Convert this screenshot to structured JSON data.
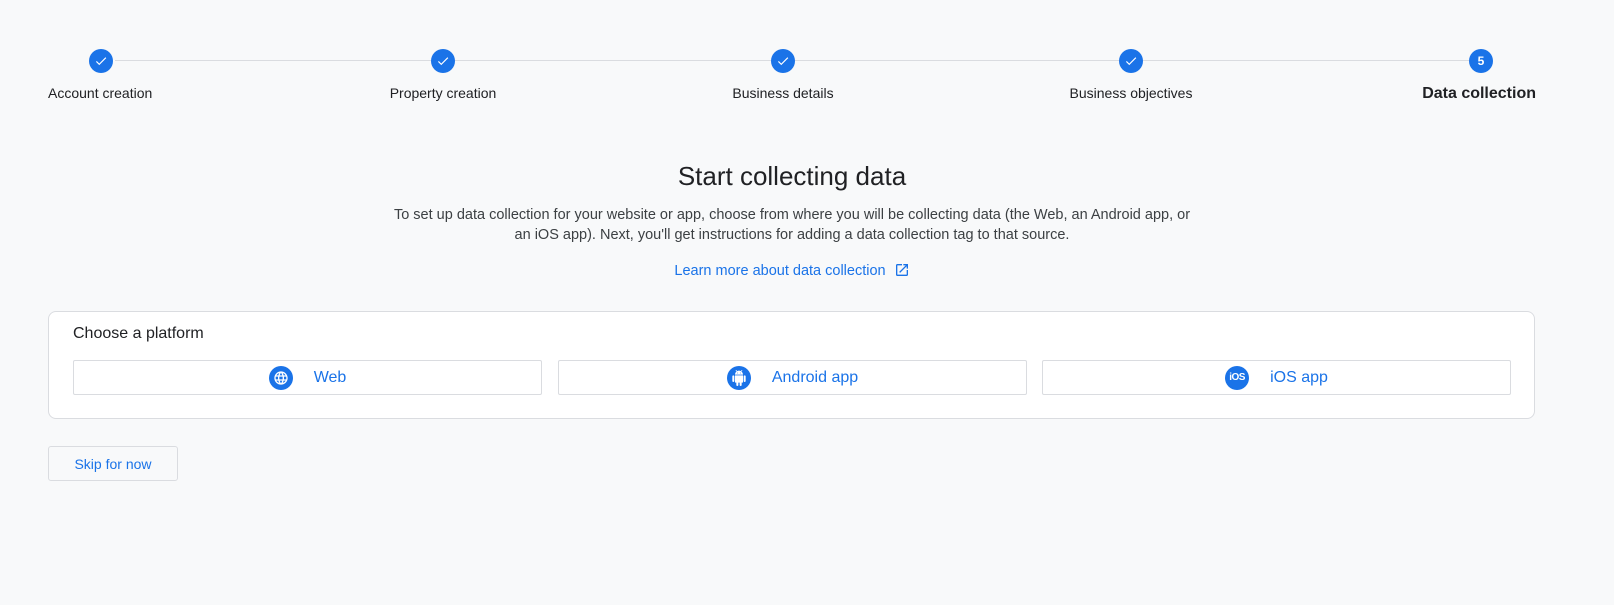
{
  "stepper": {
    "steps": [
      {
        "label": "Account creation",
        "state": "done"
      },
      {
        "label": "Property creation",
        "state": "done"
      },
      {
        "label": "Business details",
        "state": "done"
      },
      {
        "label": "Business objectives",
        "state": "done"
      },
      {
        "label": "Data collection",
        "state": "current",
        "number": "5"
      }
    ]
  },
  "main": {
    "heading": "Start collecting data",
    "description": "To set up data collection for your website or app, choose from where you will be collecting data (the Web, an Android app, or an iOS app). Next, you'll get instructions for adding a data collection tag to that source.",
    "learn_more": "Learn more about data collection"
  },
  "platform_card": {
    "title": "Choose a platform",
    "web_label": "Web",
    "android_label": "Android app",
    "ios_label": "iOS app",
    "ios_icon_text": "iOS"
  },
  "footer": {
    "skip_label": "Skip for now"
  },
  "colors": {
    "accent": "#1a73e8",
    "background": "#f8f9fa",
    "border": "#dadce0"
  }
}
